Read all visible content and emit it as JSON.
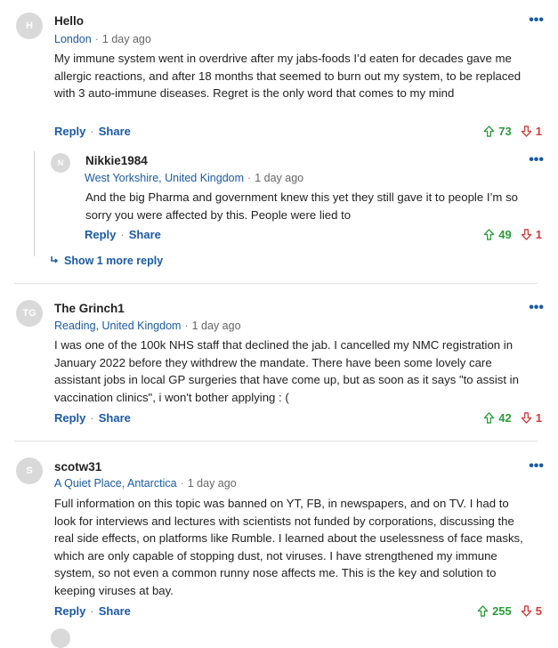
{
  "comments": [
    {
      "initials": "H",
      "name": "Hello",
      "location": "London",
      "time": "1 day ago",
      "text": "My immune system went in overdrive after my jabs-foods I’d eaten for decades gave me allergic reactions, and after 18 months that seemed to burn out my system, to be replaced with 3 auto-immune diseases. Regret is the only word that comes to my mind",
      "reply": "Reply",
      "share": "Share",
      "up": "73",
      "down": "1"
    },
    {
      "initials": "N",
      "name": "Nikkie1984",
      "location": "West Yorkshire, United Kingdom",
      "time": "1 day ago",
      "text": "And the big Pharma and government knew this yet they still gave it to people I’m so sorry you were affected by this. People were lied to",
      "reply": "Reply",
      "share": "Share",
      "up": "49",
      "down": "1"
    },
    {
      "initials": "TG",
      "name": "The Grinch1",
      "location": "Reading, United Kingdom",
      "time": "1 day ago",
      "text": "I was one of the 100k NHS staff that declined the jab.  I cancelled my NMC registration in January 2022 before they withdrew the mandate.  There have been some lovely care assistant jobs in local GP surgeries that have come up, but as soon as it says \"to assist in vaccination clinics\", i won't bother applying : (",
      "reply": "Reply",
      "share": "Share",
      "up": "42",
      "down": "1"
    },
    {
      "initials": "S",
      "name": "scotw31",
      "location": "A Quiet Place, Antarctica",
      "time": "1 day ago",
      "text": "Full information on this topic was banned on YT, FB, in newspapers, and on TV. I had to look for interviews and lectures with scientists not funded by corporations, discussing the real side effects, on platforms like Rumble. I learned about the uselessness of face masks, which are only capable of stopping dust, not viruses. I have strengthened my immune system, so not even a common runny nose affects me. This is the key and solution to keeping viruses at bay.",
      "reply": "Reply",
      "share": "Share",
      "up": "255",
      "down": "5"
    }
  ],
  "show_more_replies": "Show 1 more reply",
  "more_menu": "•••",
  "dot": "·",
  "colors": {
    "link": "#1a5aa6",
    "upvote": "#2a9d3a",
    "downvote": "#d23a3a",
    "avatar": "#d9d9d9"
  }
}
